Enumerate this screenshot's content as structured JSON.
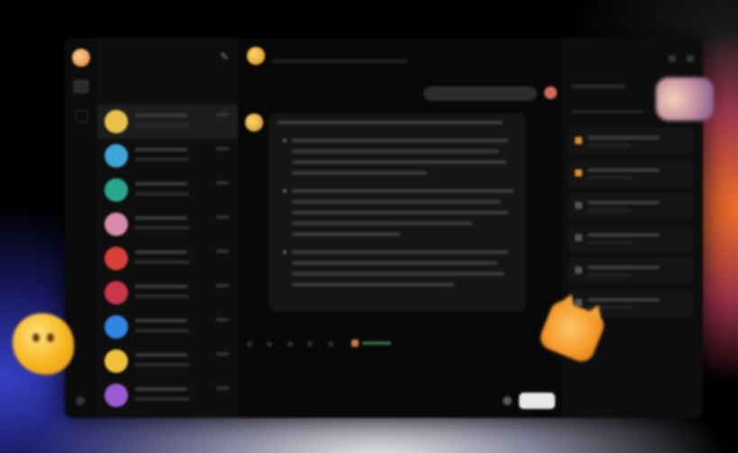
{
  "sidebar": {
    "chats": [
      {
        "avatar_color": "#e9c14a"
      },
      {
        "avatar_color": "#3aa7d6"
      },
      {
        "avatar_color": "#2aa58e"
      },
      {
        "avatar_color": "#d98aa8"
      },
      {
        "avatar_color": "#d8403a"
      },
      {
        "avatar_color": "#c9354a"
      },
      {
        "avatar_color": "#2f86e0"
      },
      {
        "avatar_color": "#f0c03a"
      },
      {
        "avatar_color": "#9b5ad0"
      }
    ]
  },
  "colors": {
    "accent": "#f7b51e",
    "window_bg": "#070707"
  }
}
